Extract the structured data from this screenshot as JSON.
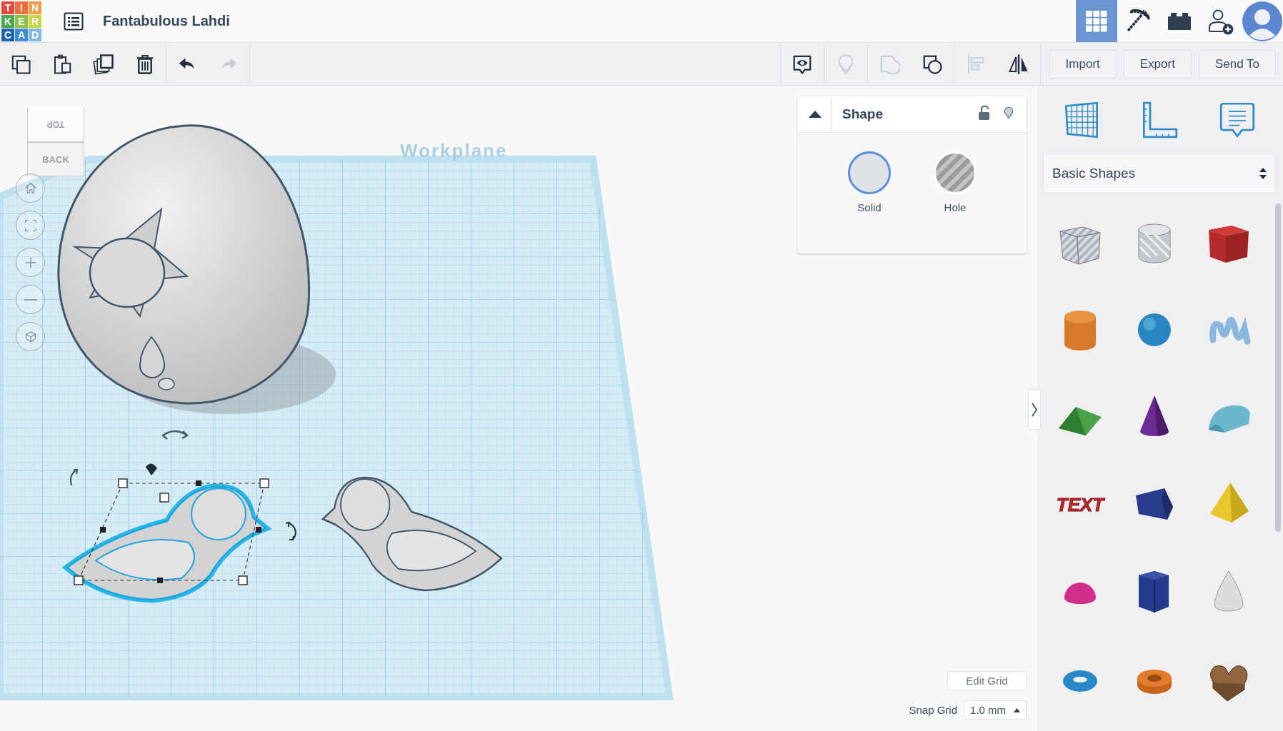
{
  "logo": [
    {
      "letter": "T",
      "color": "#e4473a"
    },
    {
      "letter": "I",
      "color": "#ee6e3d"
    },
    {
      "letter": "N",
      "color": "#f29a48"
    },
    {
      "letter": "K",
      "color": "#47a84c"
    },
    {
      "letter": "E",
      "color": "#8bc34a"
    },
    {
      "letter": "R",
      "color": "#c5d645"
    },
    {
      "letter": "C",
      "color": "#1f64b4"
    },
    {
      "letter": "A",
      "color": "#3d8bd2"
    },
    {
      "letter": "D",
      "color": "#80b8e0"
    }
  ],
  "app": {
    "title": "Fantabulous Lahdi"
  },
  "nav": [
    {
      "kind": "grid",
      "selected": true
    },
    {
      "kind": "pickaxe",
      "selected": false
    },
    {
      "kind": "bricks",
      "selected": false
    },
    {
      "kind": "invite",
      "selected": false
    },
    {
      "kind": "avatar",
      "selected": false
    }
  ],
  "toolbar_left": [
    {
      "kind": "copy",
      "disabled": false
    },
    {
      "kind": "paste",
      "disabled": false
    },
    {
      "kind": "duplicate",
      "disabled": false
    },
    {
      "kind": "delete",
      "disabled": false
    },
    {
      "kind": "undo",
      "disabled": false
    },
    {
      "kind": "redo",
      "disabled": true
    }
  ],
  "toolbar_right": [
    {
      "kind": "show",
      "disabled": false
    },
    {
      "kind": "bulb",
      "disabled": true
    },
    {
      "kind": "merged",
      "disabled": true
    },
    {
      "kind": "combine",
      "disabled": false
    },
    {
      "kind": "align",
      "disabled": true
    },
    {
      "kind": "mirror",
      "disabled": false
    }
  ],
  "actions": [
    "Import",
    "Export",
    "Send To"
  ],
  "viewcube": {
    "top": "TOP",
    "back": "BACK"
  },
  "workplane": {
    "label": "Workplane"
  },
  "view_controls": [
    {
      "kind": "home"
    },
    {
      "kind": "fit"
    },
    {
      "kind": "zoom-in"
    },
    {
      "kind": "zoom-out"
    },
    {
      "kind": "perspective"
    }
  ],
  "inspector": {
    "title": "Shape",
    "options": [
      {
        "kind": "solid",
        "label": "Solid",
        "selected": true
      },
      {
        "kind": "hole",
        "label": "Hole",
        "selected": false
      }
    ]
  },
  "library": {
    "tools": [
      {
        "kind": "workplane"
      },
      {
        "kind": "ruler"
      },
      {
        "kind": "notes"
      }
    ],
    "category": "Basic Shapes",
    "shapes": [
      {
        "kind": "box-hole"
      },
      {
        "kind": "cylinder-hole"
      },
      {
        "kind": "box"
      },
      {
        "kind": "cylinder"
      },
      {
        "kind": "sphere"
      },
      {
        "kind": "scribble"
      },
      {
        "kind": "roof"
      },
      {
        "kind": "cone"
      },
      {
        "kind": "round-roof"
      },
      {
        "kind": "text",
        "label": "TEXT"
      },
      {
        "kind": "polygon"
      },
      {
        "kind": "pyramid"
      },
      {
        "kind": "half-sphere"
      },
      {
        "kind": "prism"
      },
      {
        "kind": "paraboloid"
      },
      {
        "kind": "torus"
      },
      {
        "kind": "tube"
      },
      {
        "kind": "heart"
      }
    ]
  },
  "grid": {
    "edit_button": "Edit Grid",
    "snap_label": "Snap Grid",
    "snap_value": "1.0 mm"
  }
}
